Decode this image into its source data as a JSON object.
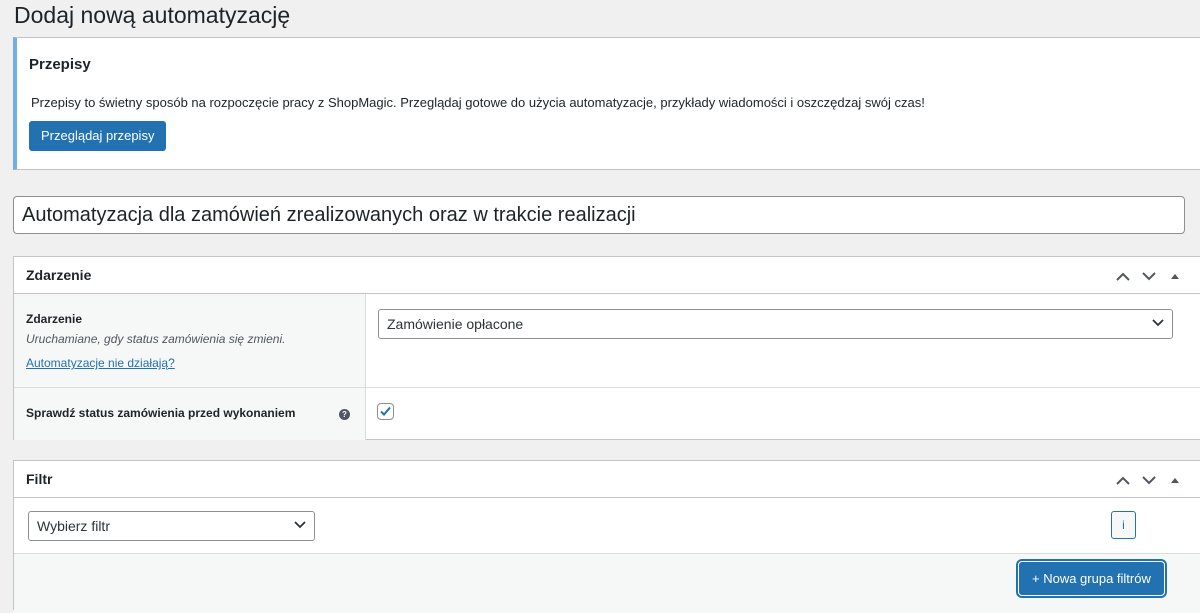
{
  "page": {
    "title": "Dodaj nową automatyzację"
  },
  "notice": {
    "title": "Przepisy",
    "text": "Przepisy to świetny sposób na rozpoczęcie pracy z ShopMagic. Przeglądaj gotowe do użycia automatyzacje, przykłady wiadomości i oszczędzaj swój czas!",
    "button_label": "Przeglądaj przepisy"
  },
  "automation_title": {
    "value": "Automatyzacja dla zamówień zrealizowanych oraz w trakcie realizacji"
  },
  "event_box": {
    "title": "Zdarzenie",
    "event_row": {
      "label": "Zdarzenie",
      "description": "Uruchamiane, gdy status zamówienia się zmieni.",
      "link": "Automatyzacje nie działają?",
      "selected": "Zamówienie opłacone"
    },
    "check_row": {
      "label": "Sprawdź status zamówienia przed wykonaniem",
      "help_glyph": "?",
      "checked": true
    }
  },
  "filter_box": {
    "title": "Filtr",
    "select_value": "Wybierz filtr",
    "info_label": "i",
    "add_group_label": "+ Nowa grupa filtrów"
  },
  "icons": {
    "postbox_controls": [
      "chevron-up-icon",
      "chevron-down-icon",
      "triangle-up-icon"
    ]
  },
  "colors": {
    "accent": "#2271b1",
    "notice_border": "#72aee6",
    "background": "#f0f0f1"
  }
}
